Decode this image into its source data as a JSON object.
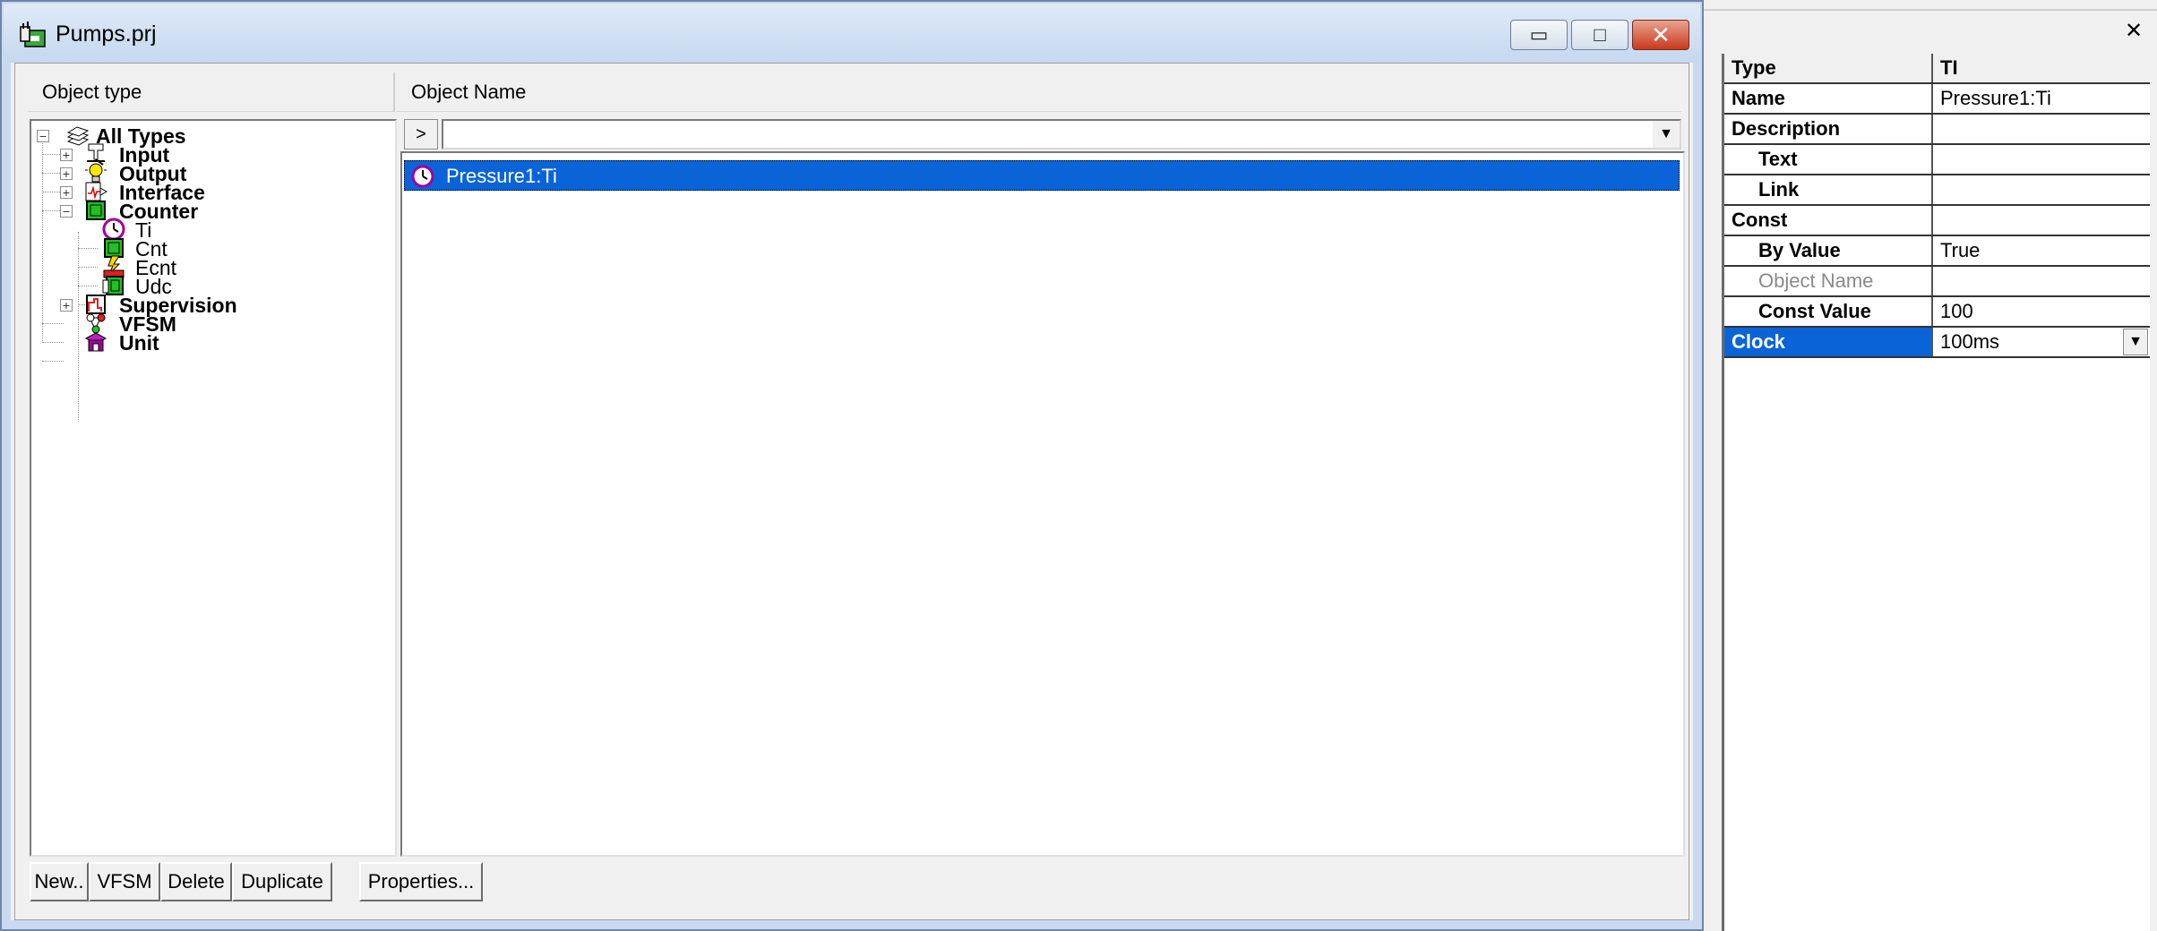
{
  "window": {
    "title": "Pumps.prj",
    "minimize_glyph": "▭",
    "maximize_glyph": "□",
    "close_glyph": "✕"
  },
  "headers": {
    "object_type": "Object type",
    "object_name": "Object Name"
  },
  "tree": {
    "root": "All Types",
    "items": [
      {
        "label": "Input",
        "icon": "input-icon"
      },
      {
        "label": "Output",
        "icon": "lightbulb-icon"
      },
      {
        "label": "Interface",
        "icon": "interface-icon"
      },
      {
        "label": "Counter",
        "icon": "counter-icon"
      },
      {
        "label": "Ti",
        "icon": "clock-icon"
      },
      {
        "label": "Cnt",
        "icon": "counter-icon"
      },
      {
        "label": "Ecnt",
        "icon": "event-counter-icon"
      },
      {
        "label": "Udc",
        "icon": "updown-counter-icon"
      },
      {
        "label": "Supervision",
        "icon": "supervision-icon"
      },
      {
        "label": "VFSM",
        "icon": "vfsm-icon"
      },
      {
        "label": "Unit",
        "icon": "unit-icon"
      }
    ]
  },
  "filter": {
    "button": ">",
    "value": "",
    "arrow": "▼"
  },
  "list": {
    "items": [
      {
        "label": "Pressure1:Ti",
        "icon": "clock-icon",
        "selected": true
      }
    ]
  },
  "buttons": {
    "new": "New..",
    "vfsm": "VFSM",
    "delete": "Delete",
    "duplicate": "Duplicate",
    "properties": "Properties..."
  },
  "properties": {
    "close_glyph": "✕",
    "rows": [
      {
        "key": "Type",
        "value": "TI"
      },
      {
        "key": "Name",
        "value": "Pressure1:Ti"
      },
      {
        "key": "Description",
        "value": ""
      },
      {
        "key": "Text",
        "value": ""
      },
      {
        "key": "Link",
        "value": ""
      },
      {
        "key": "Const",
        "value": ""
      },
      {
        "key": "By Value",
        "value": "True"
      },
      {
        "key": "Object Name",
        "value": ""
      },
      {
        "key": "Const Value",
        "value": "100"
      },
      {
        "key": "Clock",
        "value": "100ms"
      }
    ],
    "dropdown_arrow": "▼"
  },
  "colors": {
    "selection": "#0a64d8",
    "titlebar": "#c9daf0",
    "close_button": "#c83a1e"
  }
}
